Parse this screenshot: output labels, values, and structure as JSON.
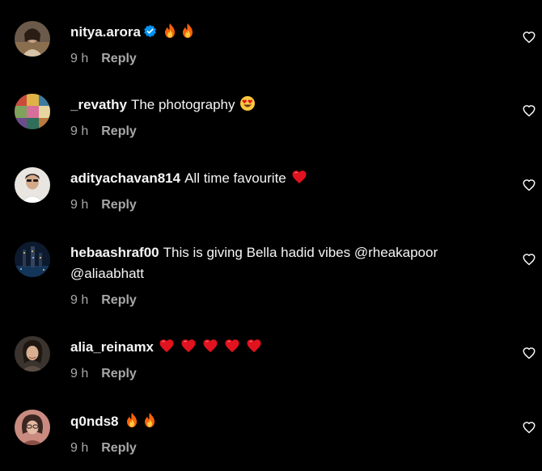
{
  "theme": {
    "background": "#000000",
    "text": "#f5f5f5",
    "muted": "#a8a8a8",
    "verified": "#0095f6",
    "heart_emoji": "#e0131f"
  },
  "comments": [
    {
      "username": "nitya.arora",
      "verified": true,
      "text": "",
      "emojis": [
        "fire-emoji",
        "fire-emoji"
      ],
      "time": "9 h",
      "reply": "Reply",
      "like_icon": "heart-outline-icon"
    },
    {
      "username": "_revathy",
      "verified": false,
      "text": "The photography",
      "emojis": [
        "heart-eyes-emoji"
      ],
      "time": "9 h",
      "reply": "Reply",
      "like_icon": "heart-outline-icon"
    },
    {
      "username": "adityachavan814",
      "verified": false,
      "text": "All time favourite",
      "emojis": [
        "red-heart-emoji"
      ],
      "time": "9 h",
      "reply": "Reply",
      "like_icon": "heart-outline-icon"
    },
    {
      "username": "hebaashraf00",
      "verified": false,
      "text": "This is giving Bella hadid vibes @rheakapoor @aliaabhatt",
      "emojis": [],
      "time": "9 h",
      "reply": "Reply",
      "like_icon": "heart-outline-icon"
    },
    {
      "username": "alia_reinamx",
      "verified": false,
      "text": "",
      "emojis": [
        "red-heart-emoji",
        "red-heart-emoji",
        "red-heart-emoji",
        "red-heart-emoji",
        "red-heart-emoji"
      ],
      "time": "9 h",
      "reply": "Reply",
      "like_icon": "heart-outline-icon"
    },
    {
      "username": "q0nds8",
      "verified": false,
      "text": "",
      "emojis": [
        "fire-emoji",
        "fire-emoji"
      ],
      "time": "9 h",
      "reply": "Reply",
      "like_icon": "heart-outline-icon"
    }
  ]
}
